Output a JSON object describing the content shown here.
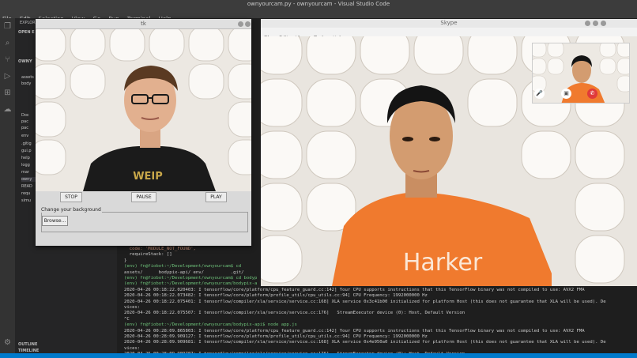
{
  "vscode": {
    "title": "ownyourcam.py - ownyourcam - Visual Studio Code",
    "menu": [
      "File",
      "Edit",
      "Selection",
      "View",
      "Go",
      "Run",
      "Terminal",
      "Help"
    ],
    "sidebar": {
      "header": "EXPLORER",
      "open_editors": "OPEN E",
      "project": "OWNY",
      "rows": [
        "assets",
        "body",
        "Doc",
        "pac",
        "pac",
        "env",
        ".gitig",
        "gui.p",
        "help",
        "logg",
        "mar",
        "owny",
        "READ",
        "requ",
        "simu"
      ],
      "outline": "OUTLINE",
      "timeline": "TIMELINE"
    }
  },
  "terminal": {
    "lines": [
      {
        "text": "  code: 'MODULE_NOT_FOUND',",
        "kind": "err"
      },
      {
        "text": "  requireStack: []",
        "kind": "plain"
      },
      {
        "text": "}",
        "kind": "plain"
      },
      {
        "text": "(env) fn@fiobot:~/Development/ownyourcam$ cd",
        "kind": "prompt"
      },
      {
        "text": "assets/      bodypix-api/ env/          .git/",
        "kind": "plain"
      },
      {
        "text": "(env) fn@fiobot:~/Development/ownyourcam$ cd bodyp",
        "kind": "prompt"
      },
      {
        "text": "(env) fn@fiobot:~/Development/ownyourcam/bodypix-a",
        "kind": "prompt"
      },
      {
        "text": "2020-04-26 00:18:22.020403: I tensorflow/core/platform/cpu_feature_guard.cc:142] Your CPU supports instructions that this TensorFlow binary was not compiled to use: AVX2 FMA",
        "kind": "plain"
      },
      {
        "text": "2020-04-26 00:18:22.073482: I tensorflow/core/platform/profile_utils/cpu_utils.cc:94] CPU Frequency: 1992000000 Hz",
        "kind": "plain"
      },
      {
        "text": "2020-04-26 00:18:22.075401: I tensorflow/compiler/xla/service/service.cc:168] XLA service 0x3c41b00 initialized for platform Host (this does not guarantee that XLA will be used). De",
        "kind": "plain"
      },
      {
        "text": "vices:",
        "kind": "plain"
      },
      {
        "text": "2020-04-26 00:18:22.075507: I tensorflow/compiler/xla/service/service.cc:176]   StreamExecutor device (0): Host, Default Version",
        "kind": "plain"
      },
      {
        "text": "^C",
        "kind": "plain"
      },
      {
        "text": "(env) fn@fiobot:~/Development/ownyourcam/bodypix-api$ node app.js",
        "kind": "prompt"
      },
      {
        "text": "2020-04-26 00:28:09.865803: I tensorflow/core/platform/cpu_feature_guard.cc:142] Your CPU supports instructions that this TensorFlow binary was not compiled to use: AVX2 FMA",
        "kind": "plain"
      },
      {
        "text": "2020-04-26 00:28:09.909127: I tensorflow/core/platform/profile_utils/cpu_utils.cc:94] CPU Frequency: 1992000000 Hz",
        "kind": "plain"
      },
      {
        "text": "2020-04-26 00:28:09.909681: I tensorflow/compiler/xla/service/service.cc:168] XLA service 0x4e950a0 initialized for platform Host (this does not guarantee that XLA will be used). De",
        "kind": "plain"
      },
      {
        "text": "vices:",
        "kind": "plain"
      },
      {
        "text": "2020-04-26 00:28:09.909707: I tensorflow/compiler/xla/service/service.cc:176]   StreamExecutor device (0): Host, Default Version",
        "kind": "plain"
      }
    ]
  },
  "tk": {
    "title": "tk",
    "buttons": {
      "stop": "STOP",
      "pause": "PAUSE",
      "play": "PLAY"
    },
    "group_label": "Change your background",
    "browse": "Browse..."
  },
  "skype": {
    "title": "Skype",
    "menu": [
      "File",
      "Edit",
      "View",
      "Tools",
      "Help"
    ],
    "shirt_text": "Harker",
    "tk_shirt_text": "WEIP"
  },
  "colors": {
    "vscode_bg": "#1e1e1e",
    "statusbar": "#007acc",
    "shirt_orange": "#f07a2e",
    "prompt_green": "#6ec27a"
  }
}
